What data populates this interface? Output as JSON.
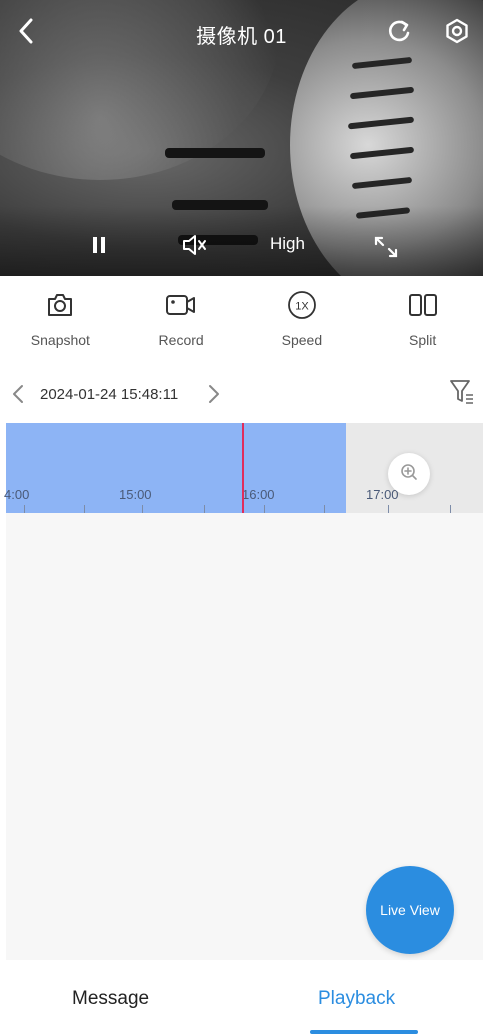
{
  "video": {
    "camera_title": "摄像机 01",
    "quality_label": "High"
  },
  "toolbar": {
    "items": [
      {
        "label": "Snapshot",
        "icon": "camera-icon"
      },
      {
        "label": "Record",
        "icon": "video-record-icon"
      },
      {
        "label": "Speed",
        "icon": "speed-1x-icon",
        "badge": "1X"
      },
      {
        "label": "Split",
        "icon": "split-screen-icon"
      }
    ]
  },
  "date_row": {
    "datetime": "2024-01-24 15:48:11"
  },
  "timeline": {
    "labels": [
      "4:00",
      "15:00",
      "16:00",
      "17:00"
    ]
  },
  "live_button": {
    "label": "Live View"
  },
  "bottom_nav": {
    "tabs": [
      {
        "label": "Message",
        "active": false
      },
      {
        "label": "Playback",
        "active": true
      }
    ]
  },
  "colors": {
    "accent": "#2b8de0",
    "timeline_recorded": "#8db4f5",
    "cursor": "#e02d5c"
  }
}
